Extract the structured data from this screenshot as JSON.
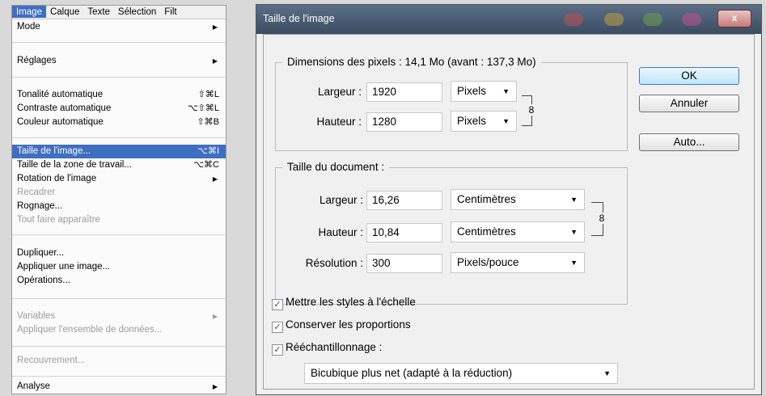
{
  "menubar": {
    "items": [
      "Image",
      "Calque",
      "Texte",
      "Sélection",
      "Filt"
    ]
  },
  "menu": {
    "items": [
      {
        "label": "Mode",
        "shortcut": "",
        "submenu": true
      },
      {
        "label": "Réglages",
        "shortcut": "",
        "submenu": true
      },
      {
        "label": "Tonalité automatique",
        "shortcut": "⇧⌘L"
      },
      {
        "label": "Contraste automatique",
        "shortcut": "⌥⇧⌘L"
      },
      {
        "label": "Couleur automatique",
        "shortcut": "⇧⌘B"
      },
      {
        "label": "Taille de l'image...",
        "shortcut": "⌥⌘I",
        "highlighted": true
      },
      {
        "label": "Taille de la zone de travail...",
        "shortcut": "⌥⌘C"
      },
      {
        "label": "Rotation de l'image",
        "shortcut": "",
        "submenu": true
      },
      {
        "label": "Recadrer",
        "shortcut": "",
        "disabled": true
      },
      {
        "label": "Rognage...",
        "shortcut": ""
      },
      {
        "label": "Tout faire apparaître",
        "shortcut": "",
        "disabled": true
      },
      {
        "label": "Dupliquer...",
        "shortcut": ""
      },
      {
        "label": "Appliquer une image...",
        "shortcut": ""
      },
      {
        "label": "Opérations...",
        "shortcut": ""
      },
      {
        "label": "Variables",
        "shortcut": "",
        "submenu": true,
        "disabled": true
      },
      {
        "label": "Appliquer l'ensemble de données...",
        "shortcut": "",
        "disabled": true
      },
      {
        "label": "Recouvrement...",
        "shortcut": "",
        "disabled": true
      },
      {
        "label": "Analyse",
        "shortcut": "",
        "submenu": true
      }
    ]
  },
  "dialog": {
    "title": "Taille de l'image",
    "close_glyph": "x",
    "pixel_dimensions": {
      "legend": "Dimensions des pixels : 14,1 Mo (avant : 137,3 Mo)",
      "width_label": "Largeur :",
      "width_value": "1920",
      "width_unit": "Pixels",
      "height_label": "Hauteur :",
      "height_value": "1280",
      "height_unit": "Pixels"
    },
    "document_size": {
      "legend": "Taille du document :",
      "width_label": "Largeur :",
      "width_value": "16,26",
      "width_unit": "Centimètres",
      "height_label": "Hauteur :",
      "height_value": "10,84",
      "height_unit": "Centimètres",
      "resolution_label": "Résolution :",
      "resolution_value": "300",
      "resolution_unit": "Pixels/pouce"
    },
    "checkboxes": {
      "scale_styles": {
        "label": "Mettre les styles à l'échelle",
        "checked": true
      },
      "constrain": {
        "label": "Conserver les proportions",
        "checked": true
      },
      "resample": {
        "label": "Rééchantillonnage :",
        "checked": true
      }
    },
    "resample_method": "Bicubique plus net (adapté à la réduction)",
    "buttons": {
      "ok": "OK",
      "cancel": "Annuler",
      "auto": "Auto..."
    },
    "check_glyph": "✓",
    "dropdown_glyph": "▼",
    "link_glyph": "8",
    "submenu_glyph": "▶"
  }
}
